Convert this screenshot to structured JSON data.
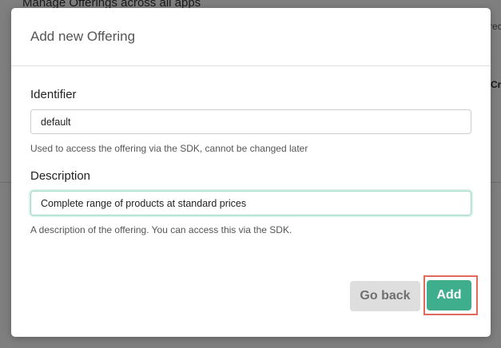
{
  "background": {
    "page_title": "Manage Offerings across all apps",
    "right_fragment_1": "rec",
    "right_fragment_2": "Cr"
  },
  "modal": {
    "title": "Add new Offering",
    "identifier": {
      "label": "Identifier",
      "value": "default",
      "help": "Used to access the offering via the SDK, cannot be changed later"
    },
    "description": {
      "label": "Description",
      "value": "Complete range of products at standard prices",
      "help": "A description of the offering. You can access this via the SDK."
    },
    "buttons": {
      "back_label": "Go back",
      "add_label": "Add"
    }
  },
  "colors": {
    "primary": "#3fae8c",
    "secondary_button": "#dedede",
    "highlight_outline": "#e26a5c",
    "focus_ring": "#9fd9c6"
  }
}
